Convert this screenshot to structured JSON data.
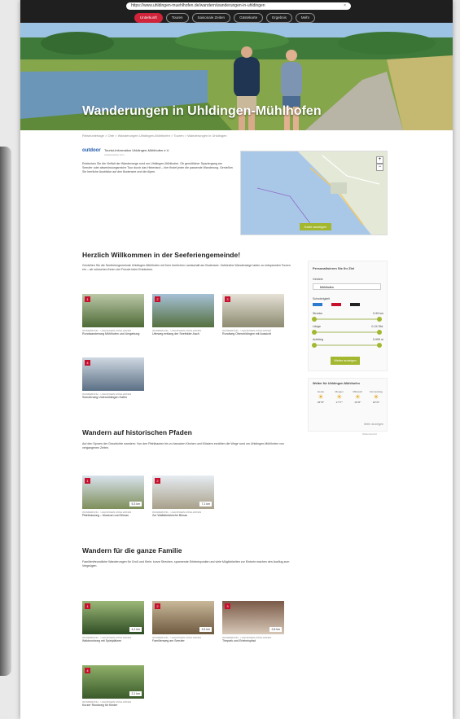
{
  "browser": {
    "url": "https://www.uhldingen-muehlhofen.de/wandern/wanderungen-in-uhldingen",
    "close": "×"
  },
  "nav": {
    "items": [
      "Unterkunft",
      "Touren",
      "Saisonale Zeiten",
      "Gästekarte",
      "Ergebnis",
      "Mehr"
    ]
  },
  "hero": {
    "title": "Wanderungen in Uhldingen-Mühlhofen"
  },
  "breadcrumb": "Reiseunterlage > Orte > Wanderungen Uhldingen-Mühlhofen > Touren > Wanderungen in Uhldingen",
  "intro": {
    "logo": "outdoor",
    "org": "Tourist-Information Uhldingen-Mühlhofen e.V.",
    "org_sub": "outdooractive.com",
    "text": "Entdecken Sie die Vielfalt der Wanderwege rund um Uhldingen-Mühlhofen. Ob gemütlicher Spaziergang am Seeufer oder abwechslungsreiche Tour durch das Hinterland – hier findet jeder die passende Wanderung. Genießen Sie herrliche Ausblicke auf den Bodensee und die Alpen.",
    "map_button": "Karte anzeigen"
  },
  "welcome": {
    "title": "Herzlich Willkommen in der Seeferiengemeinde!",
    "text": "Genießen Sie die Seeferiengemeinde Uhldingen-Mühlhofen mit ihrer herrlichen Landschaft am Bodensee. Zahlreiche Wanderwege laden zu entspannten Touren ein – wir wünschen Ihnen viel Freude beim Entdecken."
  },
  "cards_welcome": [
    {
      "n": "1",
      "meta": "WANDERUNG · UHLDINGEN-MÜHLHOFEN",
      "title": "Rundwanderweg Mühlhofen und Umgebung"
    },
    {
      "n": "2",
      "meta": "WANDERUNG · UHLDINGEN-MÜHLHOFEN",
      "title": "Uferweg entlang der Seefelder Aach"
    },
    {
      "n": "3",
      "meta": "WANDERUNG · UHLDINGEN-MÜHLHOFEN",
      "title": "Rundweg Oberuhldingen mit Aussicht"
    },
    {
      "n": "4",
      "meta": "WANDERUNG · UHLDINGEN-MÜHLHOFEN",
      "title": "Seeuferweg Unteruhldingen Hafen"
    }
  ],
  "historic": {
    "title": "Wandern auf historischen Pfaden",
    "text": "Auf den Spuren der Geschichte wandern: Von den Pfahlbauten bis zu barocken Kirchen und Klöstern erzählen die Wege rund um Uhldingen-Mühlhofen von vergangenen Zeiten."
  },
  "cards_historic": [
    {
      "n": "1",
      "meta": "WANDERUNG · UHLDINGEN-MÜHLHOFEN",
      "title": "Pfahlbauweg – Museum und Birnau",
      "tag": "5,3 km"
    },
    {
      "n": "2",
      "meta": "WANDERUNG · UHLDINGEN-MÜHLHOFEN",
      "title": "Zur Wallfahrtskirche Birnau",
      "tag": "7,1 km"
    }
  ],
  "family": {
    "title": "Wandern für die ganze Familie",
    "text": "Familienfreundliche Wanderungen für Groß und Klein: kurze Strecken, spannende Erlebnispunkte und viele Möglichkeiten zur Einkehr machen den Ausflug zum Vergnügen."
  },
  "cards_family": [
    {
      "n": "1",
      "meta": "WANDERUNG · UHLDINGEN-MÜHLHOFEN",
      "title": "Waldrundweg mit Spielplätzen",
      "tag": "4,2 km"
    },
    {
      "n": "2",
      "meta": "WANDERUNG · UHLDINGEN-MÜHLHOFEN",
      "title": "Familienweg am Seeufer",
      "tag": "3,5 km"
    },
    {
      "n": "3",
      "meta": "WANDERUNG · UHLDINGEN-MÜHLHOFEN",
      "title": "Tierpark und Erlebnispfad",
      "tag": "2,8 km"
    },
    {
      "n": "4",
      "meta": "WANDERUNG · UHLDINGEN-MÜHLHOFEN",
      "title": "Kurzer Rundweg für Kinder",
      "tag": "2,1 km"
    }
  ],
  "filter": {
    "title": "Personalisieren Sie Ihr Ziel",
    "region_label": "Gebiete",
    "region_value": "Mühlhofen",
    "difficulty_label": "Schwierigkeit",
    "difficulty": [
      "leicht",
      "mittel",
      "schwer"
    ],
    "sliders": [
      {
        "label": "Strecke",
        "value": "0-99 km"
      },
      {
        "label": "Länge",
        "value": "0-24 Std."
      },
      {
        "label": "Aufstieg",
        "value": "0-999 m"
      }
    ],
    "button": "Weiter anzeigen"
  },
  "weather": {
    "title": "Wetter für Uhldingen-Mühlhofen",
    "days": [
      {
        "d": "Heute",
        "t": "18°/8°"
      },
      {
        "d": "Morgen",
        "t": "17°/7°"
      },
      {
        "d": "Mittwoch",
        "t": "16°/6°"
      },
      {
        "d": "Donnerstag",
        "t": "19°/9°"
      }
    ],
    "link": "Mehr anzeigen",
    "footer": "Wetterbericht"
  },
  "colors": {
    "accent": "#c8102e",
    "green": "#a3b72f"
  }
}
